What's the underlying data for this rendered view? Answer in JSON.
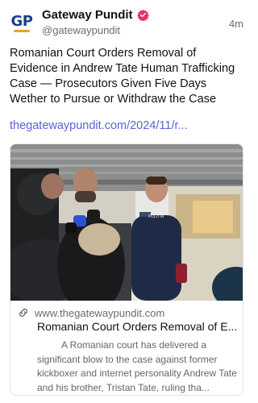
{
  "post": {
    "avatar_text": "GP",
    "display_name": "Gateway Pundit",
    "handle": "@gatewaypundit",
    "timestamp": "4m",
    "text": "Romanian Court Orders Removal of Evidence in Andrew Tate Human Trafficking Case — Prosecutors Given Five Days Wether to Pursue or Withdraw the Case",
    "link": "thegatewaypundit.com/2024/11/r..."
  },
  "card": {
    "domain": "www.thegatewaypundit.com",
    "title": "Romanian Court Orders Removal of E...",
    "description": "A Romanian court has delivered a significant blow to the case against former kickboxer and internet personality Andrew Tate and his brother, Tristan Tate, ruling tha...",
    "image_badge": "POLITIA"
  },
  "colors": {
    "link": "#5b63d6",
    "verified": "#e8345b",
    "avatar_blue": "#1d3f8f",
    "avatar_gold": "#e5a823"
  },
  "icons": {
    "verified": "verified-badge-icon",
    "link": "link-icon"
  }
}
